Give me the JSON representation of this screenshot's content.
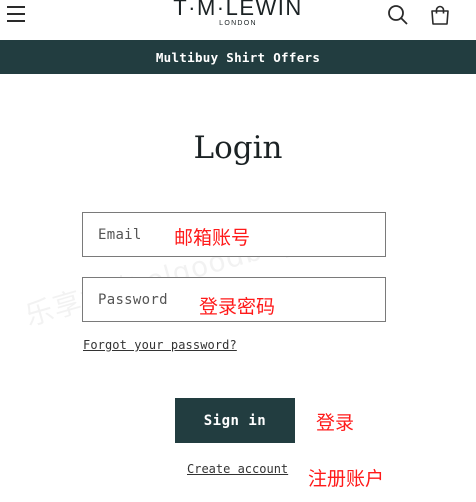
{
  "header": {
    "logo_main": "T·M·LEWIN",
    "logo_sub": "LONDON",
    "menu_icon": "hamburger-icon",
    "search_icon": "search-icon",
    "cart_icon": "cart-icon"
  },
  "promo": {
    "text": "Multibuy Shirt Offers"
  },
  "login": {
    "title": "Login",
    "email_placeholder": "Email",
    "password_placeholder": "Password",
    "forgot_label": "Forgot your password?",
    "signin_label": "Sign in",
    "create_label": "Create account"
  },
  "annotations": {
    "email": "邮箱账号",
    "password": "登录密码",
    "signin": "登录",
    "create": "注册账户"
  },
  "watermark": "乐享好物 olgoodbuy.com",
  "colors": {
    "brand": "#223d40",
    "annotation": "#ff1a1a"
  }
}
